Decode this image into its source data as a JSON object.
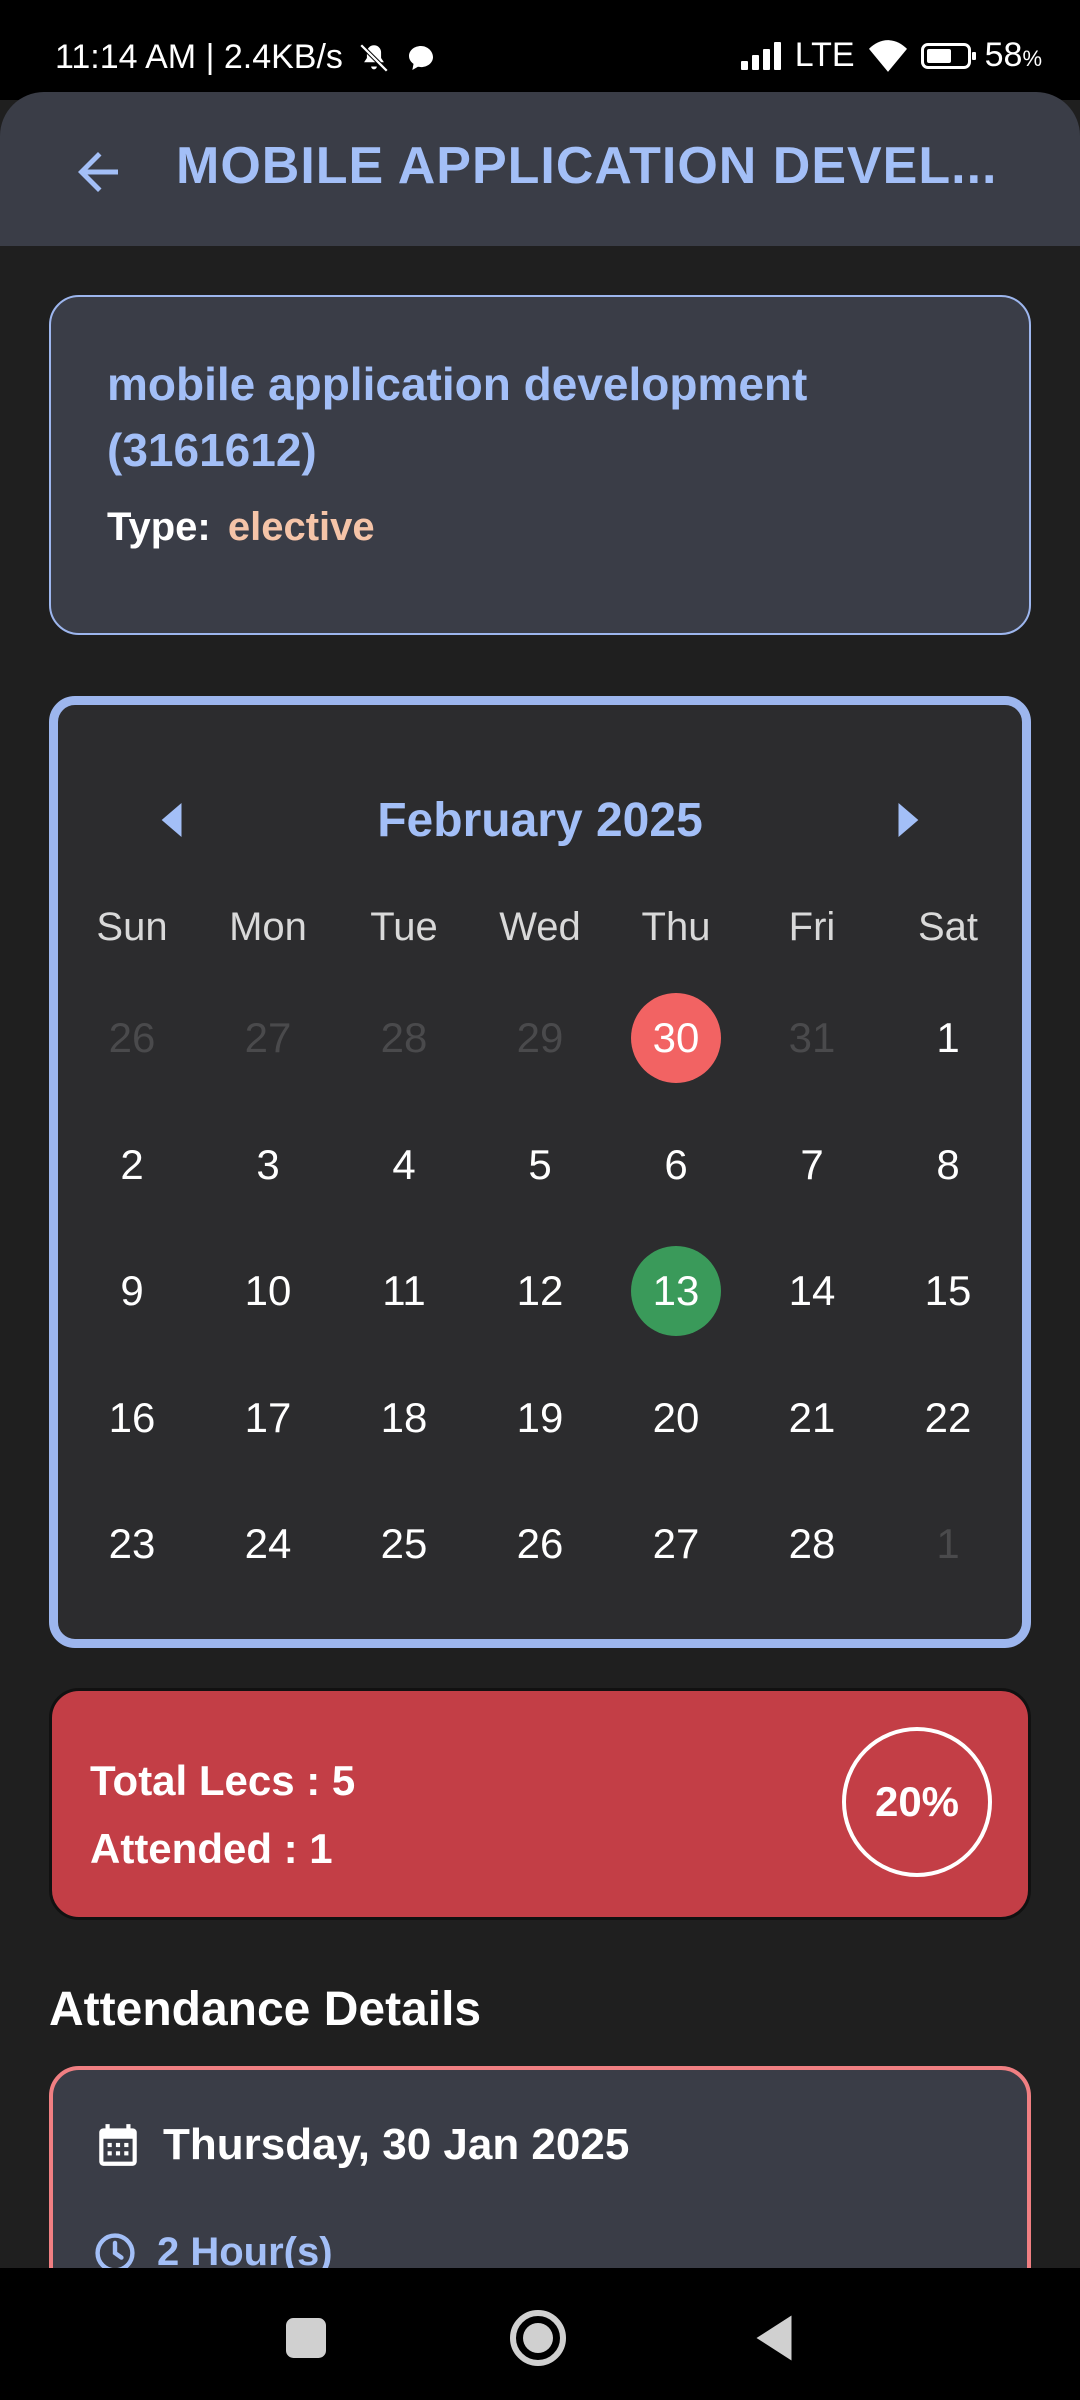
{
  "status_bar": {
    "time_speed": "11:14 AM | 2.4KB/s",
    "network": "LTE",
    "battery_value": "58",
    "battery_unit": "%"
  },
  "app_bar": {
    "title": "MOBILE APPLICATION DEVEL..."
  },
  "subject": {
    "name": "mobile application development (3161612)",
    "type_label": "Type:",
    "type_value": "elective"
  },
  "calendar": {
    "month_label": "February 2025",
    "weekdays": [
      "Sun",
      "Mon",
      "Tue",
      "Wed",
      "Thu",
      "Fri",
      "Sat"
    ],
    "days": [
      {
        "d": "26",
        "state": "muted"
      },
      {
        "d": "27",
        "state": "muted"
      },
      {
        "d": "28",
        "state": "muted"
      },
      {
        "d": "29",
        "state": "muted"
      },
      {
        "d": "30",
        "state": "absent"
      },
      {
        "d": "31",
        "state": "muted"
      },
      {
        "d": "1",
        "state": "normal"
      },
      {
        "d": "2",
        "state": "normal"
      },
      {
        "d": "3",
        "state": "normal"
      },
      {
        "d": "4",
        "state": "normal"
      },
      {
        "d": "5",
        "state": "normal"
      },
      {
        "d": "6",
        "state": "normal"
      },
      {
        "d": "7",
        "state": "normal"
      },
      {
        "d": "8",
        "state": "normal"
      },
      {
        "d": "9",
        "state": "normal"
      },
      {
        "d": "10",
        "state": "normal"
      },
      {
        "d": "11",
        "state": "normal"
      },
      {
        "d": "12",
        "state": "normal"
      },
      {
        "d": "13",
        "state": "present"
      },
      {
        "d": "14",
        "state": "normal"
      },
      {
        "d": "15",
        "state": "normal"
      },
      {
        "d": "16",
        "state": "normal"
      },
      {
        "d": "17",
        "state": "normal"
      },
      {
        "d": "18",
        "state": "normal"
      },
      {
        "d": "19",
        "state": "normal"
      },
      {
        "d": "20",
        "state": "normal"
      },
      {
        "d": "21",
        "state": "normal"
      },
      {
        "d": "22",
        "state": "normal"
      },
      {
        "d": "23",
        "state": "normal"
      },
      {
        "d": "24",
        "state": "normal"
      },
      {
        "d": "25",
        "state": "normal"
      },
      {
        "d": "26",
        "state": "normal"
      },
      {
        "d": "27",
        "state": "normal"
      },
      {
        "d": "28",
        "state": "normal"
      },
      {
        "d": "1",
        "state": "muted"
      }
    ]
  },
  "summary": {
    "total_lecs": "Total Lecs : 5",
    "attended": "Attended : 1",
    "percent": "20%"
  },
  "attendance_details": {
    "title": "Attendance Details",
    "entries": [
      {
        "date": "Thursday, 30 Jan 2025",
        "duration": "2 Hour(s)"
      }
    ]
  },
  "colors": {
    "accent": "#a3bff7",
    "absent": "#f26363",
    "present": "#3a9a5a",
    "summary_bg": "#c33e46",
    "type_value": "#f5c4a8"
  },
  "icons": [
    "back-arrow-icon",
    "calendar-icon",
    "clock-icon",
    "chevron-left-icon",
    "chevron-right-icon",
    "signal-icon",
    "wifi-icon",
    "battery-icon",
    "mute-icon",
    "chat-icon"
  ]
}
